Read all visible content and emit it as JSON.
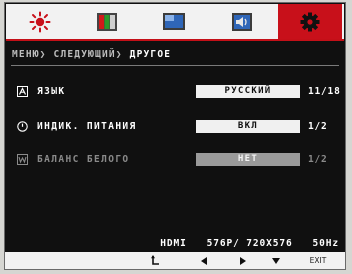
{
  "tabs": [
    {
      "icon": "brightness-icon",
      "active": false
    },
    {
      "icon": "color-icon",
      "active": false
    },
    {
      "icon": "picture-icon",
      "active": false
    },
    {
      "icon": "sound-icon",
      "active": false
    },
    {
      "icon": "gear-icon",
      "active": true
    }
  ],
  "breadcrumb": {
    "menu": "МЕНЮ❯",
    "next": "СЛЕДУЮЩИЙ❯",
    "current": "ДРУГОЕ"
  },
  "rows": [
    {
      "icon": "language-icon",
      "label": "ЯЗЫК",
      "value": "РУССКИЙ",
      "count": "11/18",
      "enabled": true
    },
    {
      "icon": "power-icon",
      "label": "ИНДИК. ПИТАНИЯ",
      "value": "ВКЛ",
      "count": "1/2",
      "enabled": true
    },
    {
      "icon": "white-balance-icon",
      "label": "БАЛАНС БЕЛОГО",
      "value": "НЕТ",
      "count": "1/2",
      "enabled": false
    }
  ],
  "status": {
    "input": "HDMI",
    "resolution": "576P/ 720X576",
    "frequency": "50Hz"
  },
  "keys": {
    "exit_label": "EXIT"
  },
  "colors": {
    "accent": "#c8101a",
    "background": "#101010"
  }
}
